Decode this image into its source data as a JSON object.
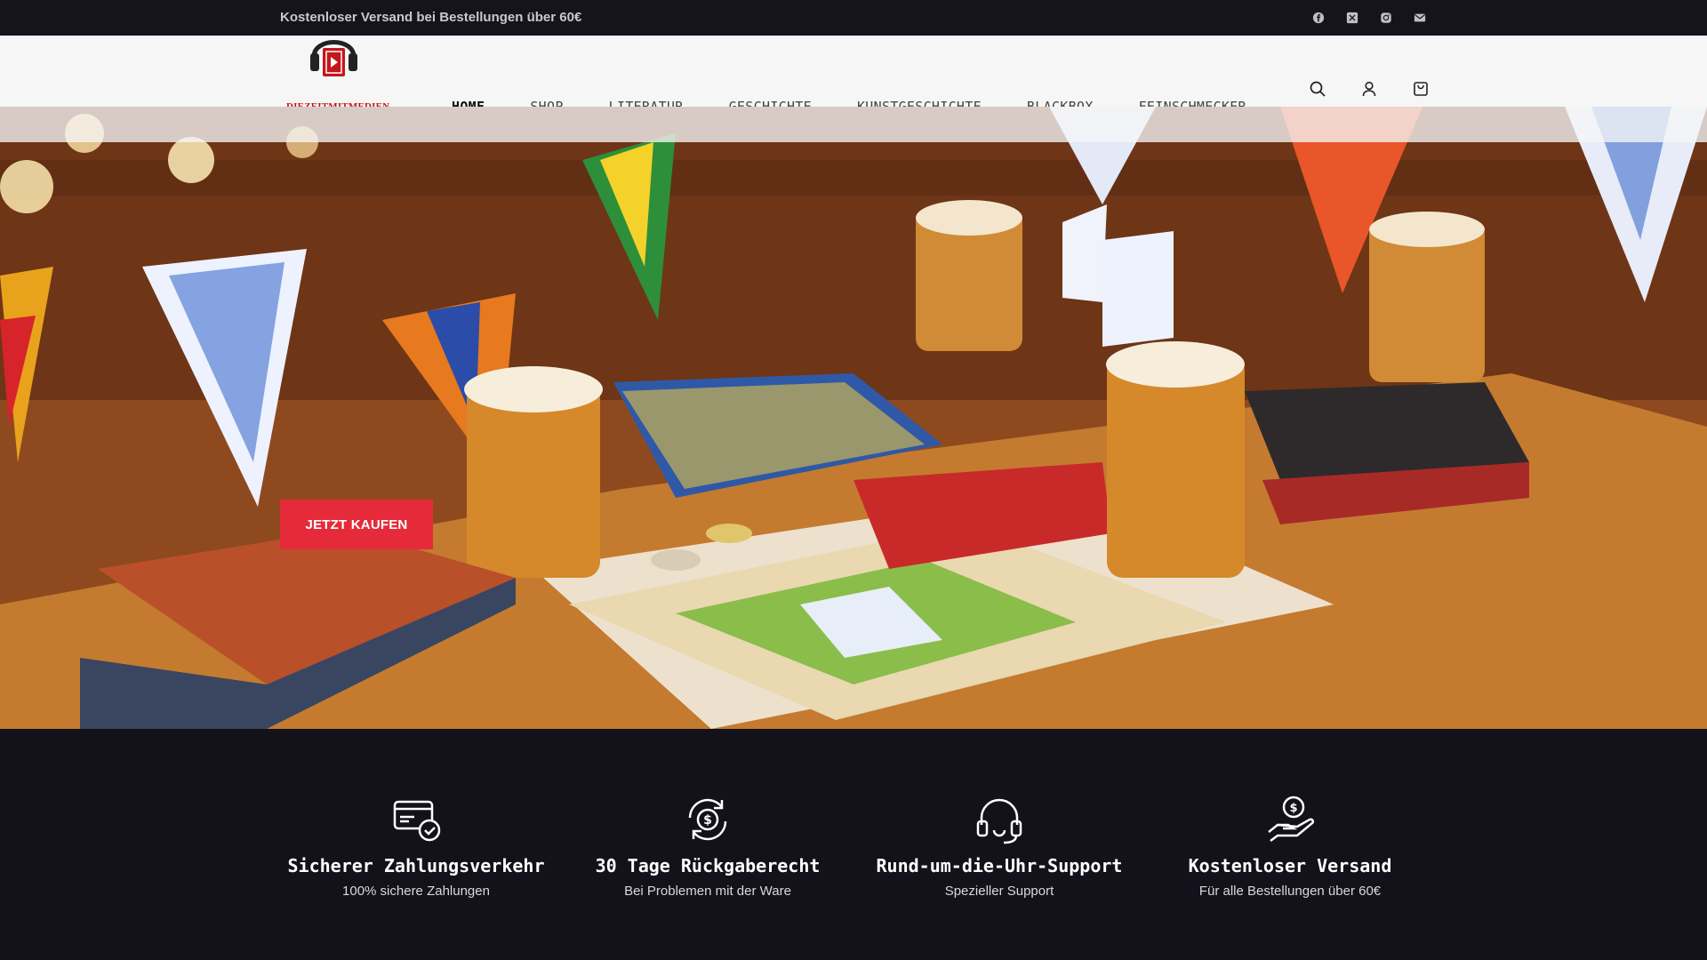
{
  "topbar": {
    "message": "Kostenloser Versand bei Bestellungen über 60€",
    "social_icons": [
      "facebook-icon",
      "x-twitter-icon",
      "instagram-icon",
      "mail-icon"
    ]
  },
  "header": {
    "logo_text": "DIEZEITMITMEDIEN",
    "nav": [
      {
        "label": "HOME",
        "active": true
      },
      {
        "label": "SHOP"
      },
      {
        "label": "LITERATUR"
      },
      {
        "label": "GESCHICHTE"
      },
      {
        "label": "KUNSTGESCHICHTE"
      },
      {
        "label": "BLACKBOX"
      },
      {
        "label": "FEINSCHMECKER"
      }
    ],
    "icons": [
      "search-icon",
      "account-icon",
      "cart-icon"
    ]
  },
  "hero": {
    "cta_label": "JETZT KAUFEN"
  },
  "features": [
    {
      "icon": "secure-payment-icon",
      "title": "Sicherer Zahlungsverkehr",
      "subtitle": "100% sichere Zahlungen"
    },
    {
      "icon": "money-return-icon",
      "title": "30 Tage Rückgaberecht",
      "subtitle": "Bei Problemen mit der Ware"
    },
    {
      "icon": "headset-support-icon",
      "title": "Rund-um-die-Uhr-Support",
      "subtitle": "Spezieller Support"
    },
    {
      "icon": "hand-money-icon",
      "title": "Kostenloser Versand",
      "subtitle": "Für alle Bestellungen über 60€"
    }
  ],
  "colors": {
    "accent": "#e52b3a",
    "dark_bg": "#13111a",
    "header_bg": "#f6f6f6",
    "logo_red": "#c4161c"
  }
}
